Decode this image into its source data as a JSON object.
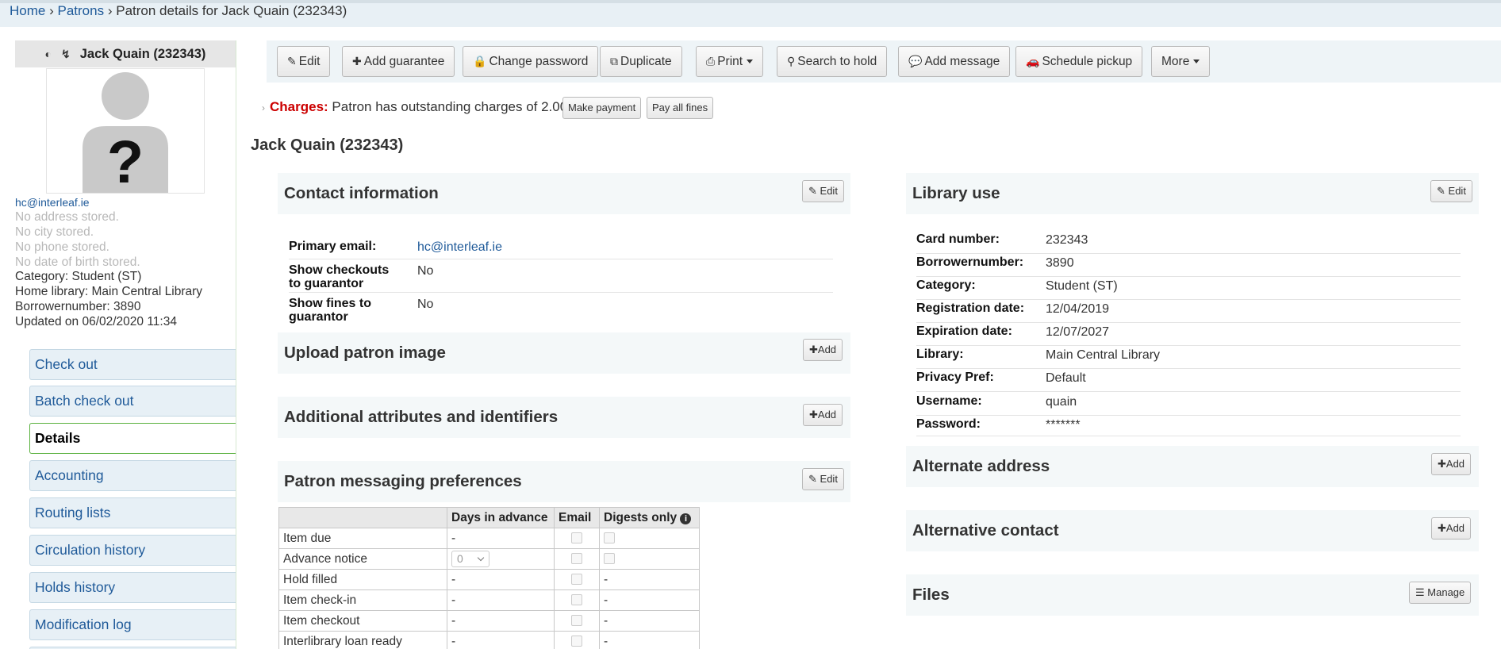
{
  "breadcrumb": {
    "home": "Home",
    "sep1": "›",
    "patrons": "Patrons",
    "sep2": "›",
    "current": "Patron details for Jack Quain (232343)"
  },
  "sidebar": {
    "title": "Jack Quain (232343)",
    "email": "hc@interleaf.ie",
    "address": "No address stored.",
    "city": "No city stored.",
    "phone": "No phone stored.",
    "dob": "No date of birth stored.",
    "category": "Category: Student (ST)",
    "home_library": "Home library: Main Central Library",
    "borrowernumber": "Borrowernumber: 3890",
    "updated": "Updated on 06/02/2020 11:34",
    "nav": [
      "Check out",
      "Batch check out",
      "Details",
      "Accounting",
      "Routing lists",
      "Circulation history",
      "Holds history",
      "Modification log"
    ]
  },
  "toolbar": {
    "edit": "Edit",
    "add_guarantee": "Add guarantee",
    "change_password": "Change password",
    "duplicate": "Duplicate",
    "print": "Print",
    "search_to_hold": "Search to hold",
    "add_message": "Add message",
    "schedule_pickup": "Schedule pickup",
    "more": "More"
  },
  "charges": {
    "label": "Charges:",
    "text": "Patron has outstanding charges of 2.00.",
    "make_payment": "Make payment",
    "pay_all": "Pay all fines"
  },
  "page_title": "Jack Quain (232343)",
  "contact": {
    "title": "Contact information",
    "edit": "Edit",
    "rows": [
      {
        "k": "Primary email:",
        "v": "hc@interleaf.ie"
      },
      {
        "k1": "Show checkouts",
        "k2": "to guarantor",
        "v": "No"
      },
      {
        "k1": "Show fines to",
        "k2": "guarantor",
        "v": "No"
      }
    ]
  },
  "upload": {
    "title": "Upload patron image",
    "add": "Add"
  },
  "attributes": {
    "title": "Additional attributes and identifiers",
    "add": "Add"
  },
  "messaging": {
    "title": "Patron messaging preferences",
    "edit": "Edit",
    "headers": [
      "",
      "Days in advance",
      "Email",
      "Digests only"
    ],
    "rows": [
      {
        "name": "Item due",
        "days": "-",
        "digest": ""
      },
      {
        "name": "Advance notice",
        "days": "0",
        "digest": ""
      },
      {
        "name": "Hold filled",
        "days": "-",
        "digest": "-"
      },
      {
        "name": "Item check-in",
        "days": "-",
        "digest": "-"
      },
      {
        "name": "Item checkout",
        "days": "-",
        "digest": "-"
      },
      {
        "name": "Interlibrary loan ready",
        "days": "-",
        "digest": "-"
      }
    ]
  },
  "library_use": {
    "title": "Library use",
    "edit": "Edit",
    "rows": [
      {
        "k": "Card number:",
        "v": "232343"
      },
      {
        "k": "Borrowernumber:",
        "v": "3890"
      },
      {
        "k": "Category:",
        "v": "Student (ST)"
      },
      {
        "k": "Registration date:",
        "v": "12/04/2019"
      },
      {
        "k": "Expiration date:",
        "v": "12/07/2027"
      },
      {
        "k": "Library:",
        "v": "Main Central Library"
      },
      {
        "k": "Privacy Pref:",
        "v": "Default"
      },
      {
        "k": "Username:",
        "v": "quain"
      },
      {
        "k": "Password:",
        "v": "*******"
      }
    ]
  },
  "alt_address": {
    "title": "Alternate address",
    "add": "Add"
  },
  "alt_contact": {
    "title": "Alternative contact",
    "add": "Add"
  },
  "files": {
    "title": "Files",
    "manage": "Manage"
  }
}
